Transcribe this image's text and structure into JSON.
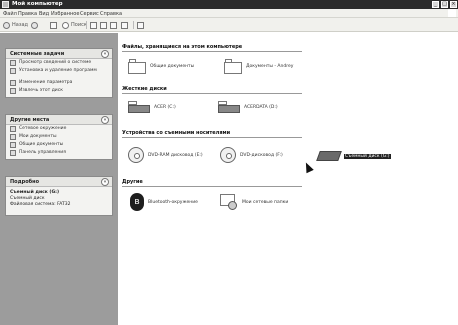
{
  "window": {
    "title": "Мой компьютер"
  },
  "menu": [
    "Файл",
    "Правка",
    "Вид",
    "Избранное",
    "Сервис",
    "Справка"
  ],
  "toolbar": {
    "back": "Назад",
    "search": "Поиск"
  },
  "sidebar": {
    "system_tasks": {
      "title": "Системные задачи",
      "items": [
        "Просмотр сведений о системе",
        "Установка и удаление программ",
        "Изменение параметра",
        "Извлечь этот диск"
      ]
    },
    "other_places": {
      "title": "Другие места",
      "items": [
        "Сетевое окружение",
        "Мои документы",
        "Общие документы",
        "Панель управления"
      ]
    },
    "details": {
      "title": "Подробно",
      "name": "Съемный диск (G:)",
      "type": "Съемный диск",
      "fs": "Файловая система: FAT32"
    }
  },
  "main": {
    "group_files": "Файлы, хранящиеся на этом компьютере",
    "shared_docs": "Общие документы",
    "andrey_docs": "Документы - Andrey",
    "group_hdd": "Жесткие диски",
    "drive_c": "ACER (C:)",
    "drive_d": "ACERDATA (D:)",
    "group_removable": "Устройства со съемными носителями",
    "drive_e": "DVD-RAM дисковод (E:)",
    "drive_f": "DVD-дисковод (F:)",
    "drive_g": "Съемный диск (G:)",
    "group_other": "Другие",
    "bluetooth": "Bluetooth-окружение",
    "network": "Мои сетевые папки"
  }
}
